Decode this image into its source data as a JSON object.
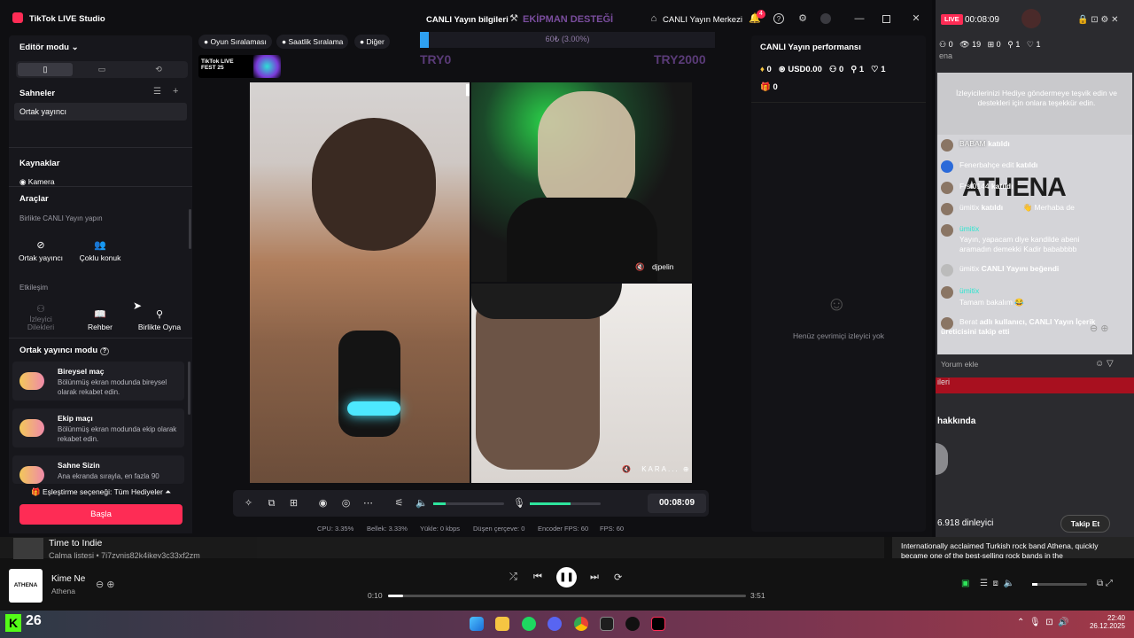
{
  "studio": {
    "title": "TikTok LIVE Studio",
    "menu": [
      "CANLI Yayın bilgileri",
      "EKİPMAN DESTEĞİ",
      "CANLI Yayın Merkezi"
    ],
    "notification_count": "4"
  },
  "left": {
    "editor_mode": "Editör modu",
    "scenes_title": "Sahneler",
    "scene_item": "Ortak yayıncı",
    "sources_title": "Kaynaklar",
    "source_item": "Kamera",
    "tools_title": "Araçlar",
    "together_title": "Birlikte CANLI Yayın yapın",
    "tools_row1": [
      "Ortak yayıncı",
      "Çoklu konuk"
    ],
    "interaction_title": "Etkileşim",
    "tools_row2": [
      "İzleyici\nDilekleri",
      "Rehber",
      "Birlikte Oyna"
    ],
    "cohost_mode_title": "Ortak yayıncı modu",
    "modes": [
      {
        "title": "Bireysel maç",
        "desc": "Bölünmüş ekran modunda bireysel olarak rekabet edin."
      },
      {
        "title": "Ekip maçı",
        "desc": "Bölünmüş ekran modunda ekip olarak rekabet edin."
      },
      {
        "title": "Sahne Sizin",
        "desc": "Ana ekranda sırayla, en fazla 90"
      }
    ],
    "match_option": "Eşleştirme seçeneği: Tüm Hediyeler",
    "start_button": "Başla"
  },
  "center": {
    "chips": [
      "Oyun Sıralaması",
      "Saatlik Sıralama",
      "Diğer"
    ],
    "goal_text": "60₺ (3.00%)",
    "goal_left": "TRY0",
    "goal_right": "TRY2000",
    "goal_progress": 3,
    "badge": "TikTok LIVE FEST 25",
    "guest1_name": "djpelin",
    "guest2_name": "KARA...",
    "timer": "00:08:09",
    "stats": [
      "CPU: 3.35%",
      "Bellek: 3.33%",
      "Yükle: 0 kbps",
      "Düşen çerçeve: 0",
      "Encoder FPS: 60",
      "FPS: 60"
    ]
  },
  "perf": {
    "title": "CANLI Yayın performansı",
    "row1": [
      "0",
      "USD0.00",
      "0",
      "1",
      "1"
    ],
    "row2": "0",
    "empty": "Henüz çevrimiçi izleyici yok"
  },
  "live": {
    "badge": "LIVE",
    "time": "00:08:09",
    "stats": [
      "0",
      "19",
      "0",
      "1",
      "1"
    ],
    "partial_label": "ena",
    "banner": "İzleyicilerinizi Hediye göndermeye teşvik edin ve destekleri için onlara teşekkür edin.",
    "chat": [
      {
        "user": "BABAM",
        "text": "katıldı"
      },
      {
        "user": "Fenerbahçe edit",
        "text": "katıldı"
      },
      {
        "user": "Frst0144",
        "text": "katıldı"
      },
      {
        "user": "ümitix",
        "text": "katıldı",
        "extra": "Merhaba de"
      },
      {
        "user": "ümitix",
        "text": "Yayın, yapacam diye kandilde abeni aramadın demekki Kadir bababbbb"
      },
      {
        "user": "ümitix",
        "text": "CANLI Yayını beğendi"
      },
      {
        "user": "ümitix",
        "text": "Tamam bakalım 😂"
      },
      {
        "user": "Berat",
        "text": "adlı kullanıcı, CANLI Yayın İçerik üreticisini takip etti"
      }
    ],
    "comment_placeholder": "Yorum ekle",
    "watermark": "ATHENA",
    "partial_red": "ileri",
    "about": "hakkında",
    "listeners": "6.918 dinleyici",
    "follow": "Takip Et",
    "bio": "Internationally acclaimed Turkish rock band Athena, quickly became one of the best-selling rock bands in the"
  },
  "player": {
    "queue_title": "Time to Indie",
    "queue_sub": "Çalma listesi • 7i7zvnis82k4ikey3c33xf2zm",
    "song": "Kime Ne",
    "artist": "Athena",
    "thumb_label": "ATHENA",
    "elapsed": "0:10",
    "total": "3:51",
    "progress": 4.3
  },
  "taskbar": {
    "kick_count": "26",
    "time": "22:40",
    "date": "26.12.2025"
  }
}
